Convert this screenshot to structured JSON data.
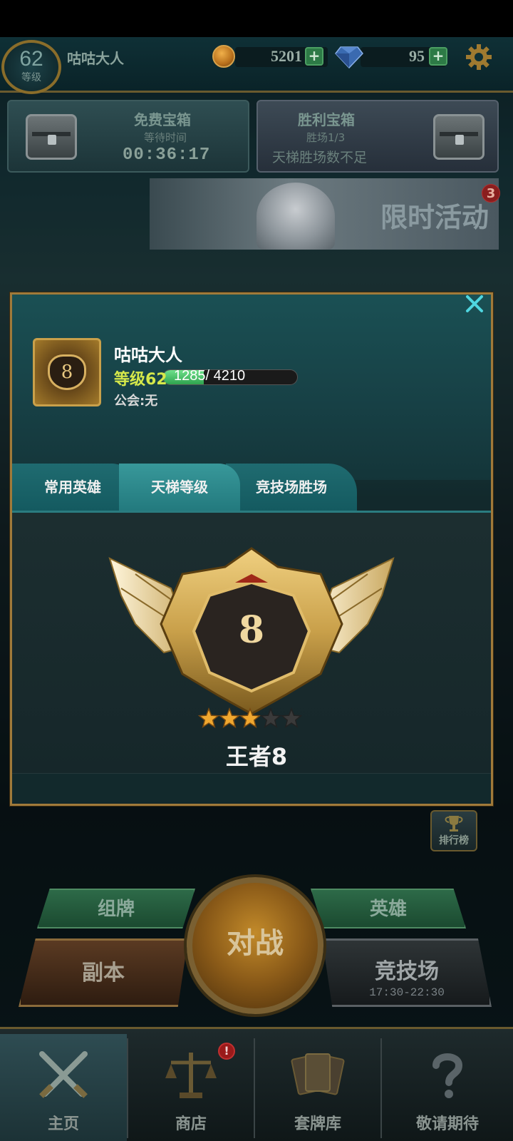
{
  "top_bar": {
    "level_number": "62",
    "level_label": "等级",
    "player_name": "咕咕大人",
    "gold": "5201",
    "gems": "95",
    "plus_symbol": "+",
    "coin_icon": "gold-coin-icon",
    "gem_icon": "diamond-icon",
    "settings_icon": "gear-icon"
  },
  "chests": {
    "free": {
      "title": "免费宝箱",
      "subtitle": "等待时间",
      "timer": "00:36:17"
    },
    "victory": {
      "title": "胜利宝箱",
      "subtitle": "胜场1/3",
      "note": "天梯胜场数不足"
    }
  },
  "event": {
    "title": "限时活动",
    "badge_count": "3"
  },
  "profile": {
    "avatar_rank": "8",
    "name": "咕咕大人",
    "level_label": "等级62",
    "exp_current": 1285,
    "exp_max": 4210,
    "exp_text": "1285/ 4210",
    "guild": "公会:无"
  },
  "tabs": [
    {
      "label": "常用英雄",
      "active": false
    },
    {
      "label": "天梯等级",
      "active": true
    },
    {
      "label": "竞技场胜场",
      "active": false
    }
  ],
  "ladder": {
    "rank_number": "8",
    "rank_name": "王者8",
    "stars_filled": 3,
    "stars_total": 5,
    "colors": {
      "star_gold": "#f0a830",
      "star_empty": "#3a3a3a",
      "emblem_gold": "#c9a04a"
    }
  },
  "leaderboard": {
    "label": "排行榜"
  },
  "actions": {
    "deck": "组牌",
    "heroes": "英雄",
    "battle": "对战",
    "dungeon": "副本",
    "arena": "竞技场",
    "arena_time": "17:30-22:30"
  },
  "nav": {
    "home": "主页",
    "shop": "商店",
    "deck_library": "套牌库",
    "coming_soon": "敬请期待",
    "shop_badge": "!"
  },
  "close_icon": "close-icon"
}
